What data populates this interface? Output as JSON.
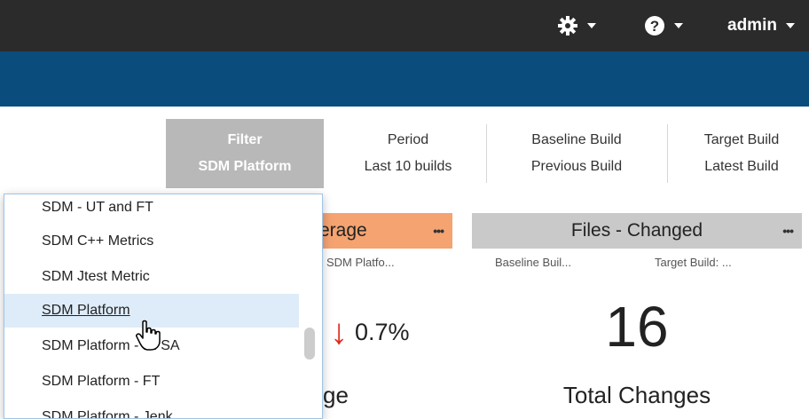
{
  "topbar": {
    "settings_icon": "gear-icon",
    "help_icon": "question-circle-icon",
    "user": "admin"
  },
  "filters": {
    "filter": {
      "label": "Filter",
      "value": "SDM Platform"
    },
    "period": {
      "label": "Period",
      "value": "Last 10 builds"
    },
    "baseline": {
      "label": "Baseline Build",
      "value": "Previous Build"
    },
    "target": {
      "label": "Target Build",
      "value": "Latest Build"
    }
  },
  "widgets": {
    "coverage": {
      "title": "erage",
      "subtitle": "SDM Platfo...",
      "arrow": "↓",
      "delta": "0.7%",
      "footer": "ge",
      "accent": "#f4a371"
    },
    "files": {
      "title": "Files - Changed",
      "baseline": "Baseline Buil...",
      "target": "Target Build: ...",
      "value": "16",
      "caption": "Total Changes",
      "accent": "#c9c9c9"
    }
  },
  "dropdown": {
    "items": [
      "SDM - UT and FT",
      "SDM C++ Metrics",
      "SDM Jtest Metric",
      "SDM Platform",
      "SDM Platform - all SA",
      "SDM Platform - FT",
      "SDM Platform - Jenk"
    ],
    "hovered": "SDM Platform"
  },
  "colors": {
    "topbar": "#2b2b2b",
    "banner": "#0a4d7d",
    "filter_active": "#b8b8b8",
    "down_arrow": "#e02b1f",
    "dropdown_hover": "#deecf9"
  }
}
